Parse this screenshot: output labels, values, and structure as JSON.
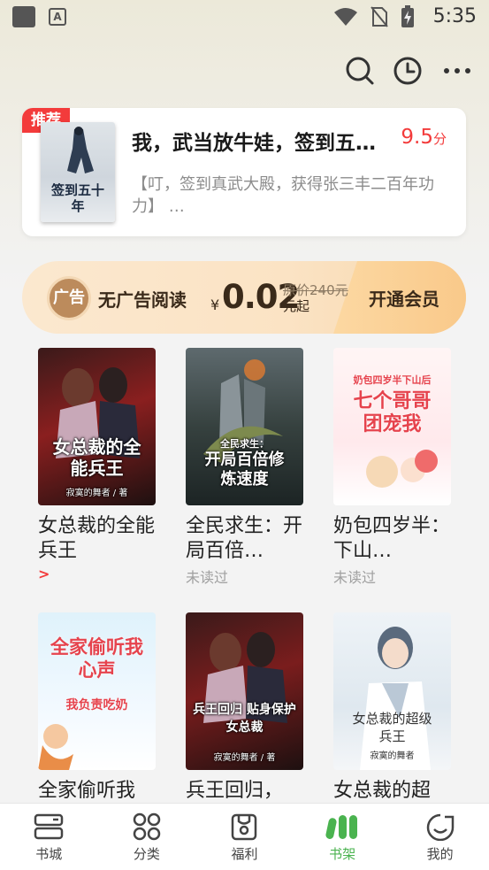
{
  "status_bar": {
    "time": "5:35",
    "app_glyph": "A"
  },
  "header": {
    "icons": [
      "search-icon",
      "clock-icon",
      "more-icon"
    ]
  },
  "recommend": {
    "badge": "推荐",
    "title": "我，武当放牛娃，签到五…",
    "score": "9.5",
    "score_unit": "分",
    "description": "【叮，签到真武大殿，获得张三丰二百年功力】 …",
    "cover_text": "签到五十年"
  },
  "vip_banner": {
    "icon_text": "广告",
    "label": "无广告阅读",
    "currency": "¥",
    "price": "0.02",
    "original_price": "原价240元",
    "suffix": "元起",
    "cta": "开通会员"
  },
  "books": [
    {
      "title": "女总裁的全能兵王",
      "sub": "",
      "arrow": ">",
      "cover_text": "女总裁的全能兵王",
      "cover_author": "寂寞的舞者 / 著"
    },
    {
      "title": "全民求生：开局百倍…",
      "sub": "未读过",
      "arrow": "",
      "cover_text": "开局百倍修炼速度",
      "cover_author": "全民求生："
    },
    {
      "title": "奶包四岁半：下山…",
      "sub": "未读过",
      "arrow": "",
      "cover_text": "七个哥哥团宠我",
      "cover_author": "奶包四岁半下山后"
    },
    {
      "title": "全家偷听我",
      "sub": "",
      "arrow": "",
      "cover_text": "全家偷听我心声",
      "cover_author": "我负责吃奶"
    },
    {
      "title": "兵王回归，",
      "sub": "",
      "arrow": "",
      "cover_text": "兵王回归 贴身保护女总裁",
      "cover_author": "寂寞的舞者 / 著"
    },
    {
      "title": "女总裁的超",
      "sub": "",
      "arrow": "",
      "cover_text": "女总裁的超级兵王",
      "cover_author": "寂寞的舞者"
    }
  ],
  "nav": {
    "items": [
      {
        "label": "书城",
        "icon": "bookstore-icon"
      },
      {
        "label": "分类",
        "icon": "category-icon"
      },
      {
        "label": "福利",
        "icon": "welfare-icon"
      },
      {
        "label": "书架",
        "icon": "bookshelf-icon"
      },
      {
        "label": "我的",
        "icon": "profile-icon"
      }
    ],
    "active_index": 3,
    "active_color": "#4ab34f"
  }
}
